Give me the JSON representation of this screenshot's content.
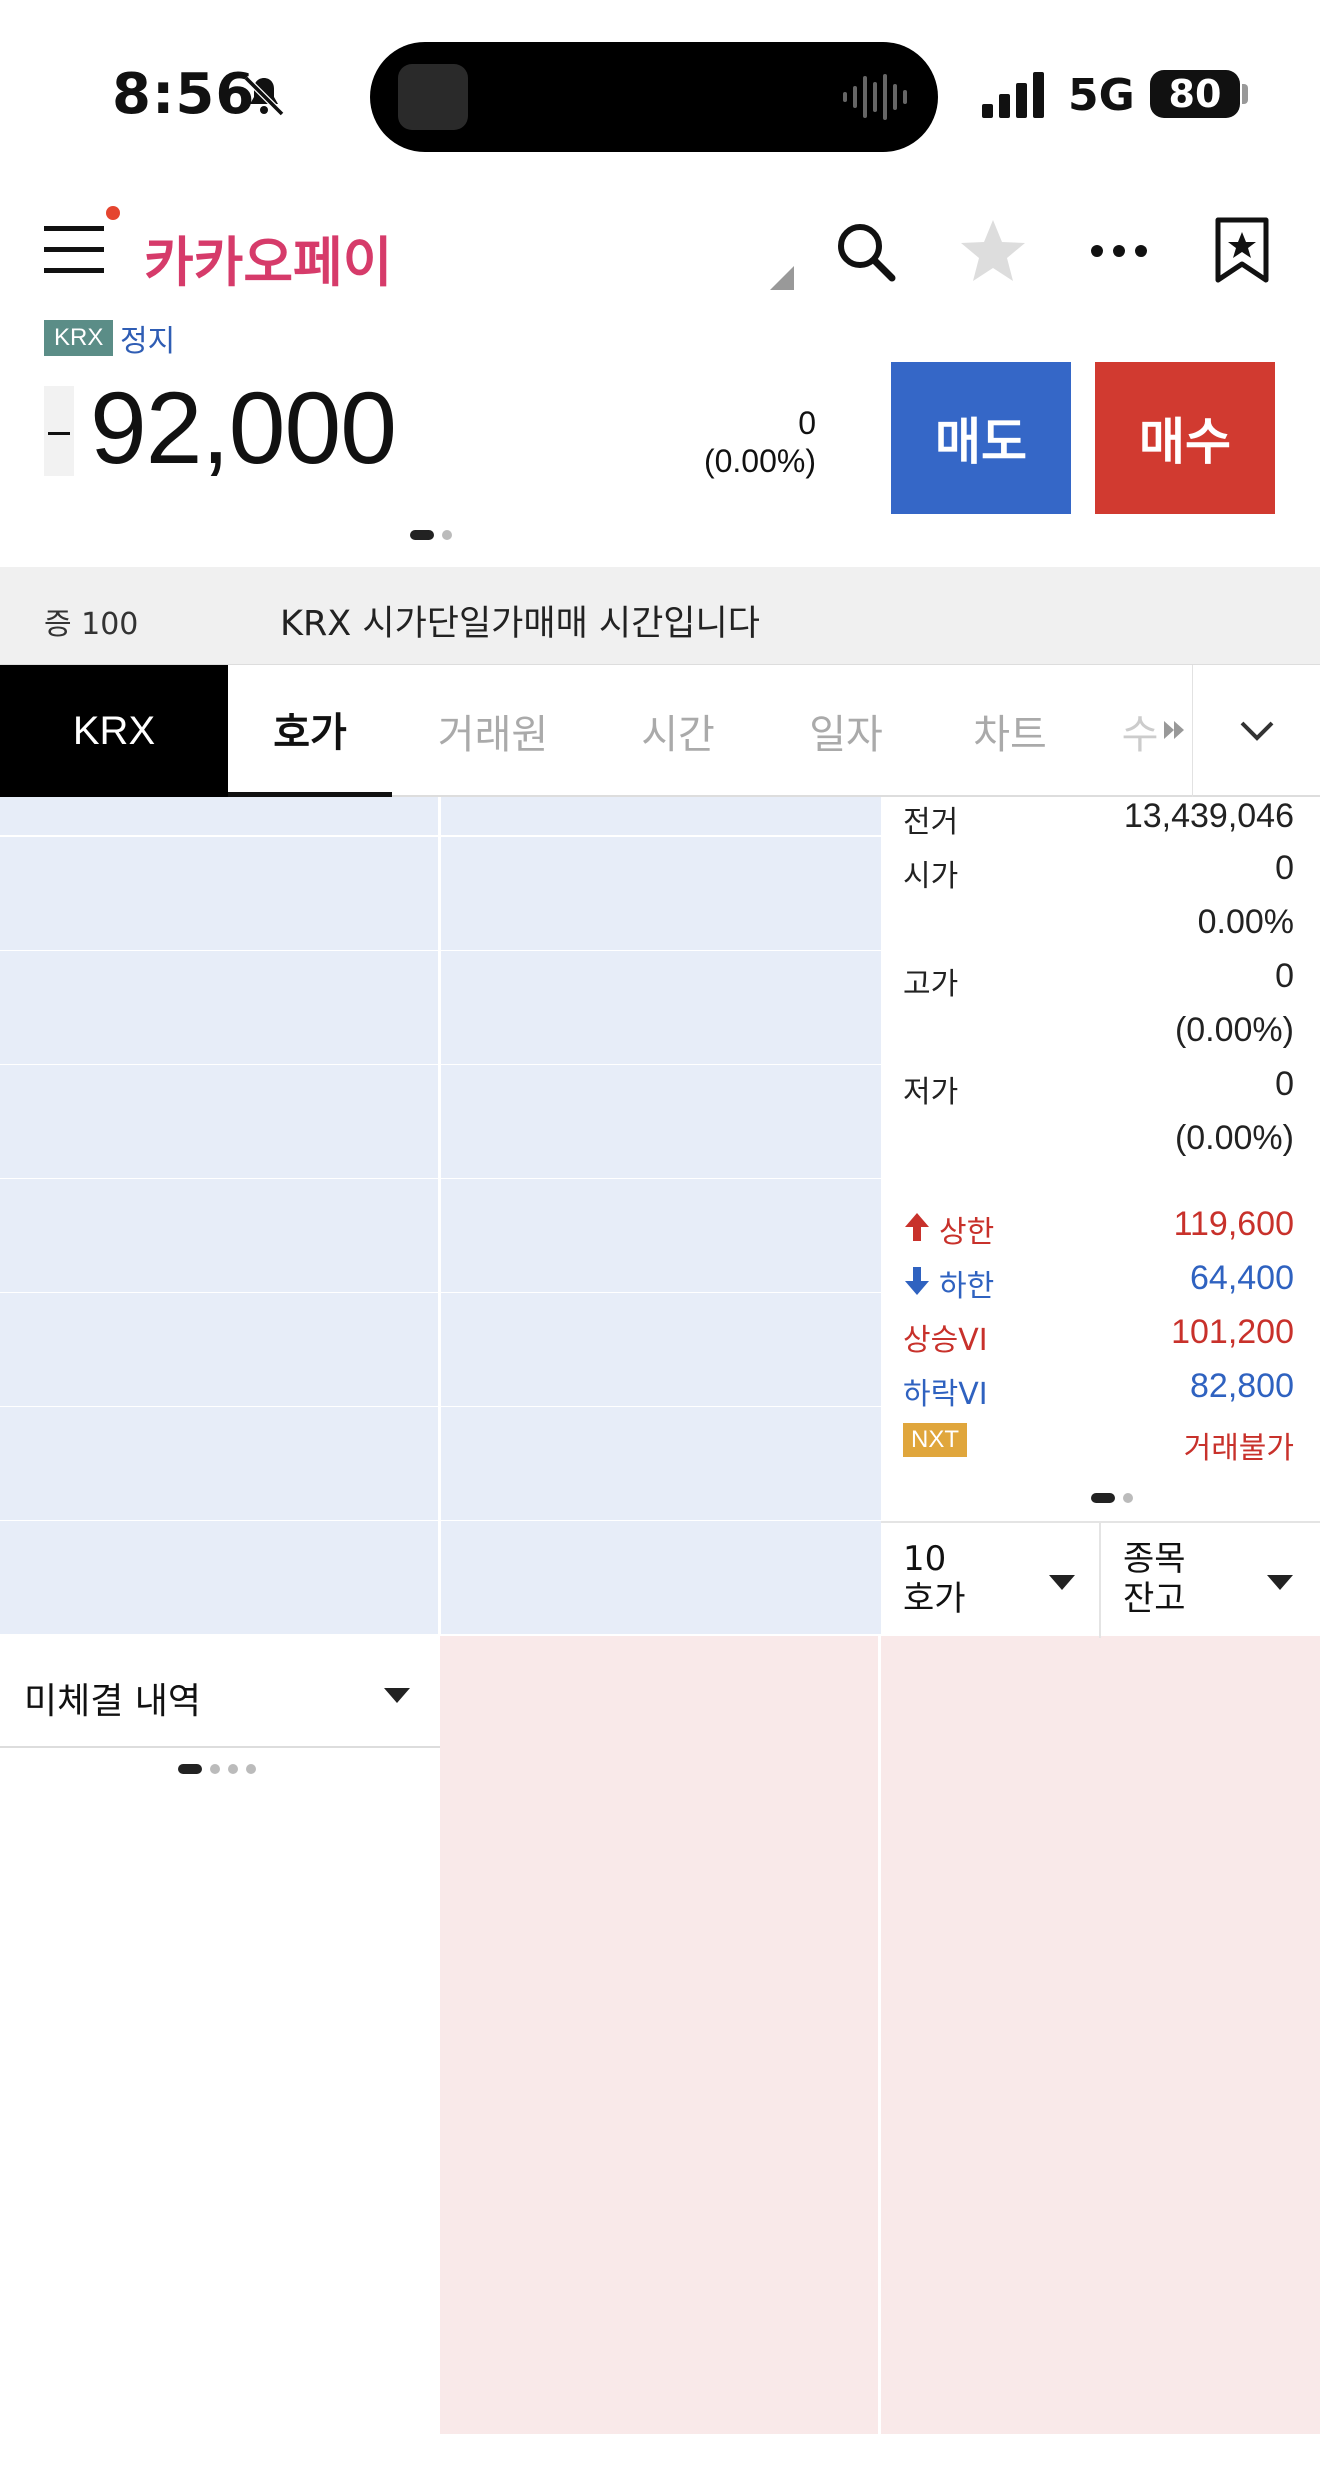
{
  "status_bar": {
    "time": "8:56",
    "network": "5G",
    "battery": "80"
  },
  "header": {
    "brand": "카카오페이"
  },
  "quote": {
    "exchange_badge": "KRX",
    "trading_state": "정지",
    "price": "92,000",
    "change": "0",
    "change_pct": "(0.00%)",
    "sell_label": "매도",
    "buy_label": "매수"
  },
  "notice": {
    "margin": "증 100",
    "text": "KRX 시가단일가매매 시간입니다"
  },
  "tabs": {
    "exchange": "KRX",
    "items": [
      "호가",
      "거래원",
      "시간",
      "일자",
      "차트",
      "수"
    ]
  },
  "info": {
    "prev_volume_label": "전거",
    "prev_volume": "13,439,046",
    "open_label": "시가",
    "open": "0",
    "open_pct": "0.00%",
    "high_label": "고가",
    "high": "0",
    "high_pct": "(0.00%)",
    "low_label": "저가",
    "low": "0",
    "low_pct": "(0.00%)",
    "upper_label": "상한",
    "upper": "119,600",
    "lower_label": "하한",
    "lower": "64,400",
    "vi_up_label": "상승VI",
    "vi_up": "101,200",
    "vi_down_label": "하락VI",
    "vi_down": "82,800",
    "nxt_badge": "NXT",
    "nxt_status": "거래불가"
  },
  "selectors": {
    "depth_line1": "10",
    "depth_line2": "호가",
    "balance_line1": "종목",
    "balance_line2": "잔고"
  },
  "pending": {
    "label": "미체결 내역"
  },
  "colors": {
    "sell": "#3567c7",
    "buy": "#d13a30",
    "brand": "#d63b6a",
    "ask_bg": "#e7edf8",
    "bid_bg": "#f9e9e9"
  }
}
